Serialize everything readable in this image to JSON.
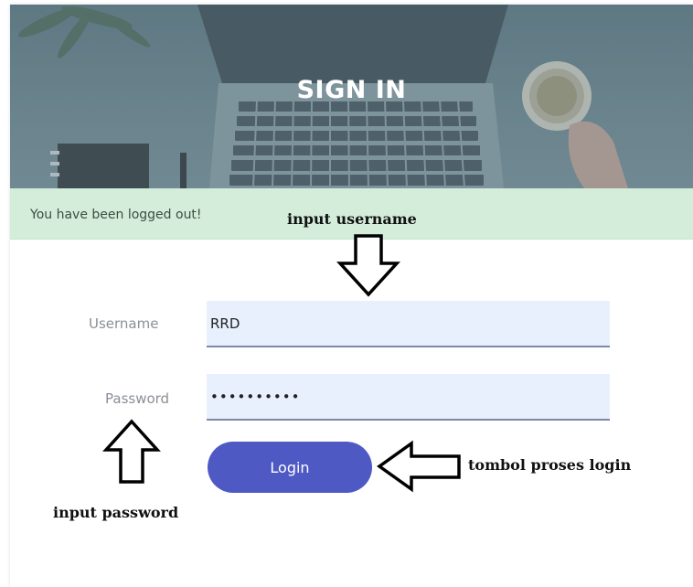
{
  "header": {
    "title": "SIGN IN"
  },
  "alert": {
    "message": "You have been logged out!"
  },
  "form": {
    "username_label": "Username",
    "username_value": "RRD",
    "password_label": "Password",
    "password_value": "••••••••••",
    "login_label": "Login"
  },
  "annotations": {
    "input_username": "input username",
    "input_password": "input password",
    "login_process": "tombol proses login"
  },
  "colors": {
    "accent": "#4e59c4",
    "alert_bg": "#d4edda",
    "input_bg": "#e8f0fe"
  }
}
